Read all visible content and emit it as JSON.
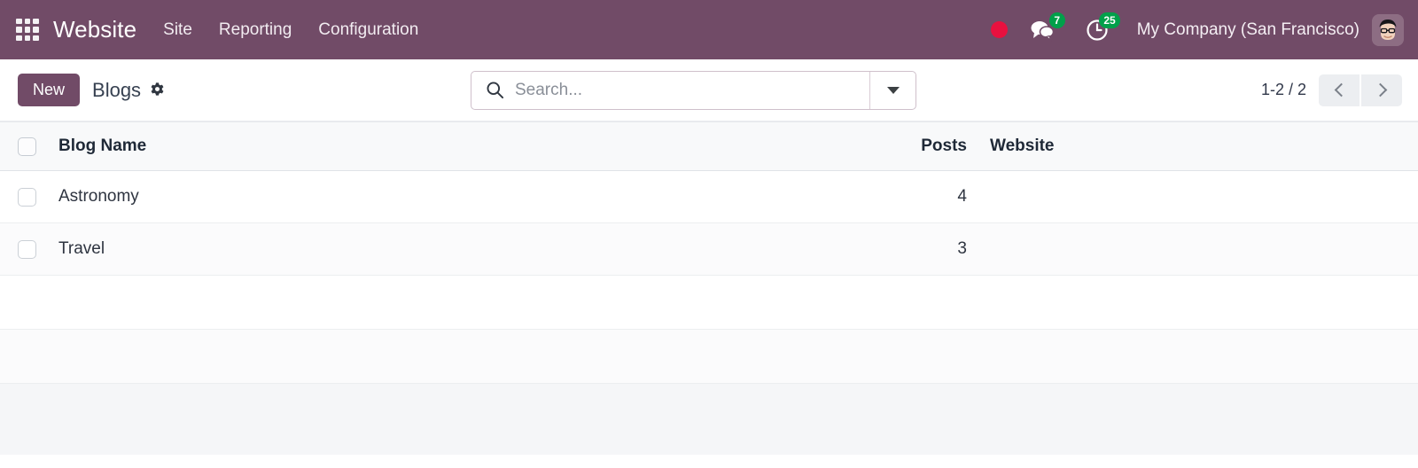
{
  "navbar": {
    "apps_icon": "apps-grid-icon",
    "brand": "Website",
    "menu": [
      {
        "label": "Site"
      },
      {
        "label": "Reporting"
      },
      {
        "label": "Configuration"
      }
    ],
    "recording_indicator": "record-dot-icon",
    "messages": {
      "icon": "messages-icon",
      "count": "7"
    },
    "activities": {
      "icon": "activity-clock-icon",
      "count": "25"
    },
    "company": "My Company (San Francisco)",
    "avatar": "user-avatar",
    "colors": {
      "background": "#714B67",
      "badge": "#00a04a",
      "record": "#e8113f"
    }
  },
  "control_panel": {
    "new_label": "New",
    "breadcrumb": "Blogs",
    "settings_icon": "gear-icon",
    "search": {
      "icon": "search-icon",
      "value": "",
      "placeholder": "Search...",
      "toggle_icon": "caret-down-icon"
    },
    "pager": {
      "range": "1-2 / 2",
      "prev_icon": "chevron-left-icon",
      "next_icon": "chevron-right-icon"
    }
  },
  "list": {
    "columns": [
      {
        "key": "name",
        "label": "Blog Name"
      },
      {
        "key": "posts",
        "label": "Posts"
      },
      {
        "key": "site",
        "label": "Website"
      }
    ],
    "rows": [
      {
        "name": "Astronomy",
        "posts": "4",
        "site": ""
      },
      {
        "name": "Travel",
        "posts": "3",
        "site": ""
      }
    ]
  }
}
